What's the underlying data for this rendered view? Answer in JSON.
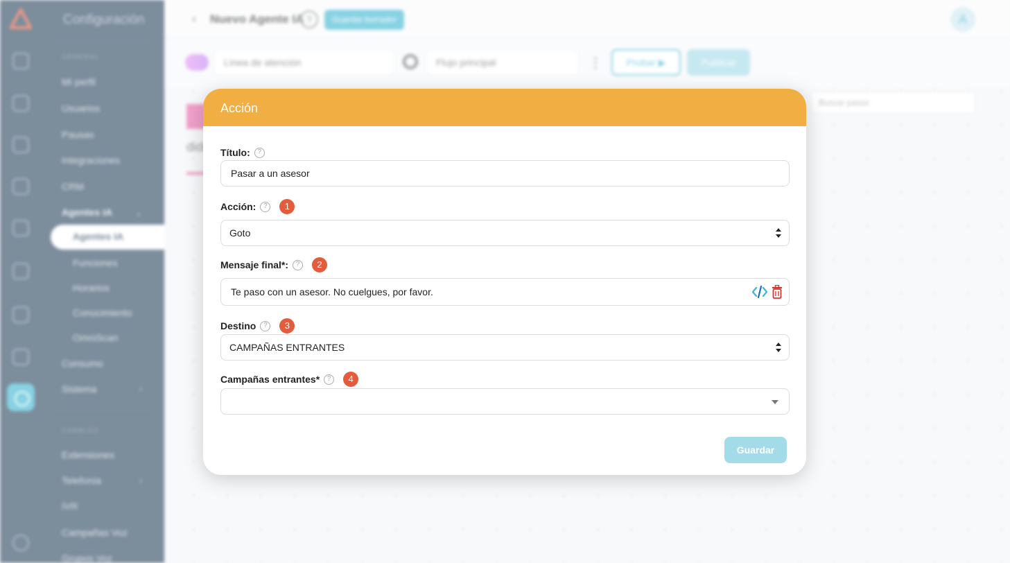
{
  "app": {
    "sidebar_title": "Configuración",
    "sections": {
      "general": "GENERAL",
      "channels": "CANALES"
    },
    "menu": {
      "profile": "Mi perfil",
      "users": "Usuarios",
      "pauses": "Pausas",
      "integrations": "Integraciones",
      "crm": "CRM",
      "ai_agents_group": "Agentes IA",
      "ai_agents": "Agentes IA",
      "functions": "Funciones",
      "schedules": "Horarios",
      "knowledge": "Conocimiento",
      "omniscan": "OmniScan",
      "consumption": "Consumo",
      "system": "Sistema",
      "extensions": "Extensiones",
      "telephony": "Telefonía",
      "ivr": "IVR",
      "voice_campaigns": "Campañas Voz",
      "voice_groups": "Grupos Voz"
    },
    "page_title": "Nuevo Agente IA",
    "help_label": "?",
    "draft_button": "Guardar borrador",
    "avatar_initial": "A",
    "line_field": "Línea de atención",
    "flow_select": "Flujo principal",
    "test_button": "Probar",
    "publish_button": "Publicar",
    "search_steps_placeholder": "Buscar pasos",
    "canvas_fragment": "dide"
  },
  "modal": {
    "title": "Acción",
    "fields": {
      "title_label": "Título:",
      "title_value": "Pasar a un asesor",
      "action_label": "Acción:",
      "action_badge": "1",
      "action_value": "Goto",
      "final_message_label": "Mensaje final*:",
      "final_message_badge": "2",
      "final_message_value": "Te paso con un asesor. No cuelgues, por favor.",
      "destination_label": "Destino",
      "destination_badge": "3",
      "destination_value": "CAMPAÑAS ENTRANTES",
      "inbound_campaigns_label": "Campañas entrantes*",
      "inbound_campaigns_badge": "4",
      "inbound_campaigns_value": ""
    },
    "save_button": "Guardar"
  },
  "colors": {
    "header": "#f1ae42",
    "badge": "#e35d3c",
    "accent": "#3fb7d2",
    "danger": "#d9342b",
    "sidebar": "#2c4760"
  }
}
